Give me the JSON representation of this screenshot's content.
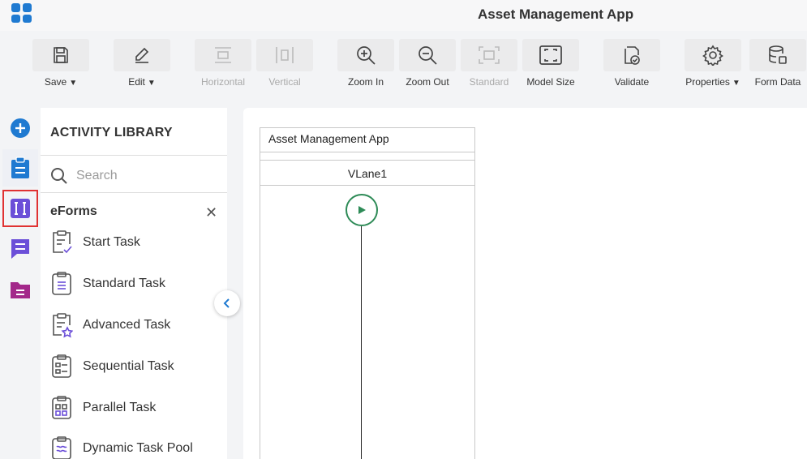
{
  "app": {
    "title": "Asset Management App"
  },
  "toolbar": {
    "save": "Save",
    "edit": "Edit",
    "horizontal": "Horizontal",
    "vertical": "Vertical",
    "zoom_in": "Zoom In",
    "zoom_out": "Zoom Out",
    "standard": "Standard",
    "model_size": "Model Size",
    "validate": "Validate",
    "properties": "Properties",
    "form_data": "Form Data"
  },
  "library": {
    "title": "ACTIVITY LIBRARY",
    "search_placeholder": "Search",
    "category": "eForms",
    "items": [
      {
        "label": "Start Task",
        "icon": "start-task-icon"
      },
      {
        "label": "Standard Task",
        "icon": "standard-task-icon"
      },
      {
        "label": "Advanced Task",
        "icon": "advanced-task-icon"
      },
      {
        "label": "Sequential Task",
        "icon": "sequential-task-icon"
      },
      {
        "label": "Parallel Task",
        "icon": "parallel-task-icon"
      },
      {
        "label": "Dynamic Task Pool",
        "icon": "dynamic-task-pool-icon"
      }
    ]
  },
  "canvas": {
    "pool_title": "Asset Management App",
    "lane_title": "VLane1"
  },
  "colors": {
    "accent_blue": "#1f7ad1",
    "purple": "#6b4fd8",
    "magenta": "#a3288a",
    "start_green": "#2e8b57",
    "highlight_red": "#e03232"
  }
}
